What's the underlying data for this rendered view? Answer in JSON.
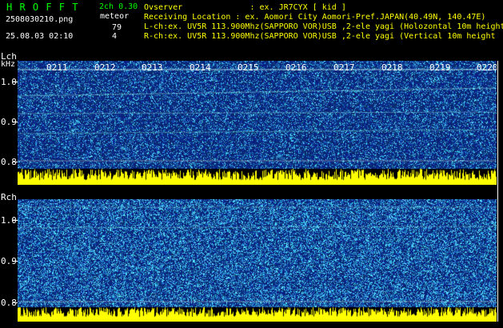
{
  "header": {
    "app_title": "H R O F F T",
    "filename": "2508030210.png",
    "datetime": "25.08.03 02:10",
    "mode": "2ch 0.30",
    "meteor_label": "meteor",
    "meteor_lch": "79",
    "meteor_rch": "4",
    "observer": "Ovserver              : ex. JR7CYX [ kid ]",
    "location": "Receiving Location : ex. Aomori City Aomori-Pref.JAPAN(40.49N, 140.47E)",
    "lch_info": "L-ch:ex. UV5R 113.900Mhz(SAPPORO VOR)USB ,2-ele yagi (Holozontal 10m height",
    "rch_info": "R-ch:ex. UV5R 113.900Mhz(SAPPORO VOR)USB ,2-ele yagi (Vertical 10m height"
  },
  "lch": {
    "label": "Lch",
    "unit": "kHz",
    "y_ticks": [
      "1.0",
      "0.9",
      "0.8"
    ],
    "time_marks": [
      "0211",
      "0212",
      "0213",
      "0214",
      "0215",
      "0216",
      "0217",
      "0218",
      "0219",
      "0220"
    ]
  },
  "rch": {
    "label": "Rch",
    "y_ticks": [
      "1.0",
      "0.9",
      "0.8"
    ]
  },
  "colors": {
    "title_green": "#00ff00",
    "text_white": "#ffffff",
    "text_yellow": "#ffff00",
    "spectrum_dark": "#0a1a6e",
    "spectrum_cyan": "#40c8ff",
    "level_yellow": "#ffff00"
  }
}
